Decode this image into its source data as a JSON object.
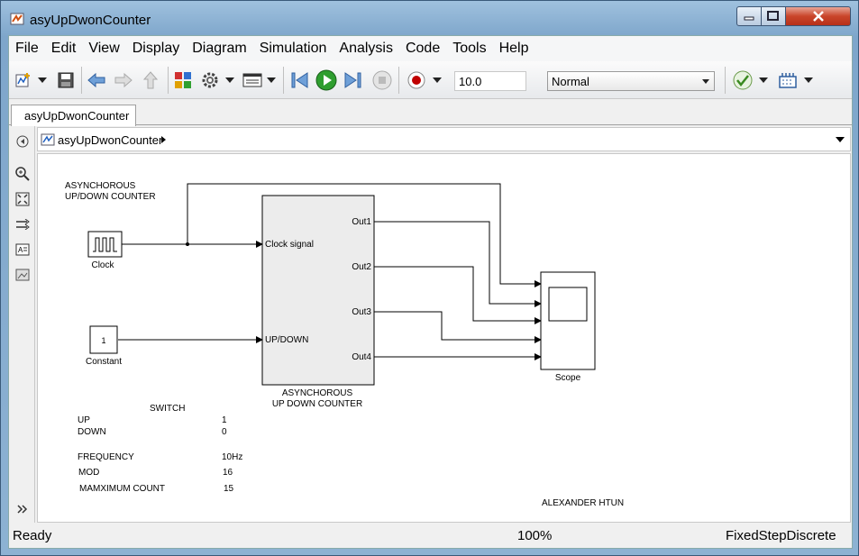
{
  "window": {
    "title": "asyUpDwonCounter"
  },
  "menu": [
    "File",
    "Edit",
    "View",
    "Display",
    "Diagram",
    "Simulation",
    "Analysis",
    "Code",
    "Tools",
    "Help"
  ],
  "toolbar": {
    "stop_time": "10.0",
    "sim_mode": "Normal",
    "icons": [
      "new-model-icon",
      "save-icon",
      "back-icon",
      "forward-icon",
      "up-icon",
      "library-icon",
      "settings-gear-icon",
      "explorer-icon",
      "step-back-icon",
      "run-icon",
      "step-forward-icon",
      "stop-icon",
      "record-icon",
      "check-icon",
      "build-icon"
    ]
  },
  "tab": {
    "label": "asyUpDwonCounter"
  },
  "breadcrumb": {
    "label": "asyUpDwonCounter"
  },
  "diagram": {
    "title_line1": "ASYNCHOROUS",
    "title_line2": "UP/DOWN COUNTER",
    "clock_label": "Clock",
    "constant_value": "1",
    "constant_label": "Constant",
    "subsystem": {
      "in1": "Clock signal",
      "in2": "UP/DOWN",
      "outs": [
        "Out1",
        "Out2",
        "Out3",
        "Out4"
      ],
      "label_line1": "ASYNCHOROUS",
      "label_line2": "UP DOWN COUNTER"
    },
    "scope_label": "Scope",
    "switch_title": "SWITCH",
    "notes": [
      {
        "k": "UP",
        "v": "1"
      },
      {
        "k": "DOWN",
        "v": "0"
      },
      {
        "k": "FREQUENCY",
        "v": "10Hz"
      },
      {
        "k": "MOD",
        "v": "16"
      },
      {
        "k": "MAMXIMUM COUNT",
        "v": "15"
      }
    ],
    "author": "ALEXANDER HTUN"
  },
  "status": {
    "ready": "Ready",
    "zoom": "100%",
    "solver": "FixedStepDiscrete"
  },
  "colors": {
    "run_green": "#2f9e2f",
    "record_red": "#c00000",
    "subsystem_fill": "#ececec"
  }
}
